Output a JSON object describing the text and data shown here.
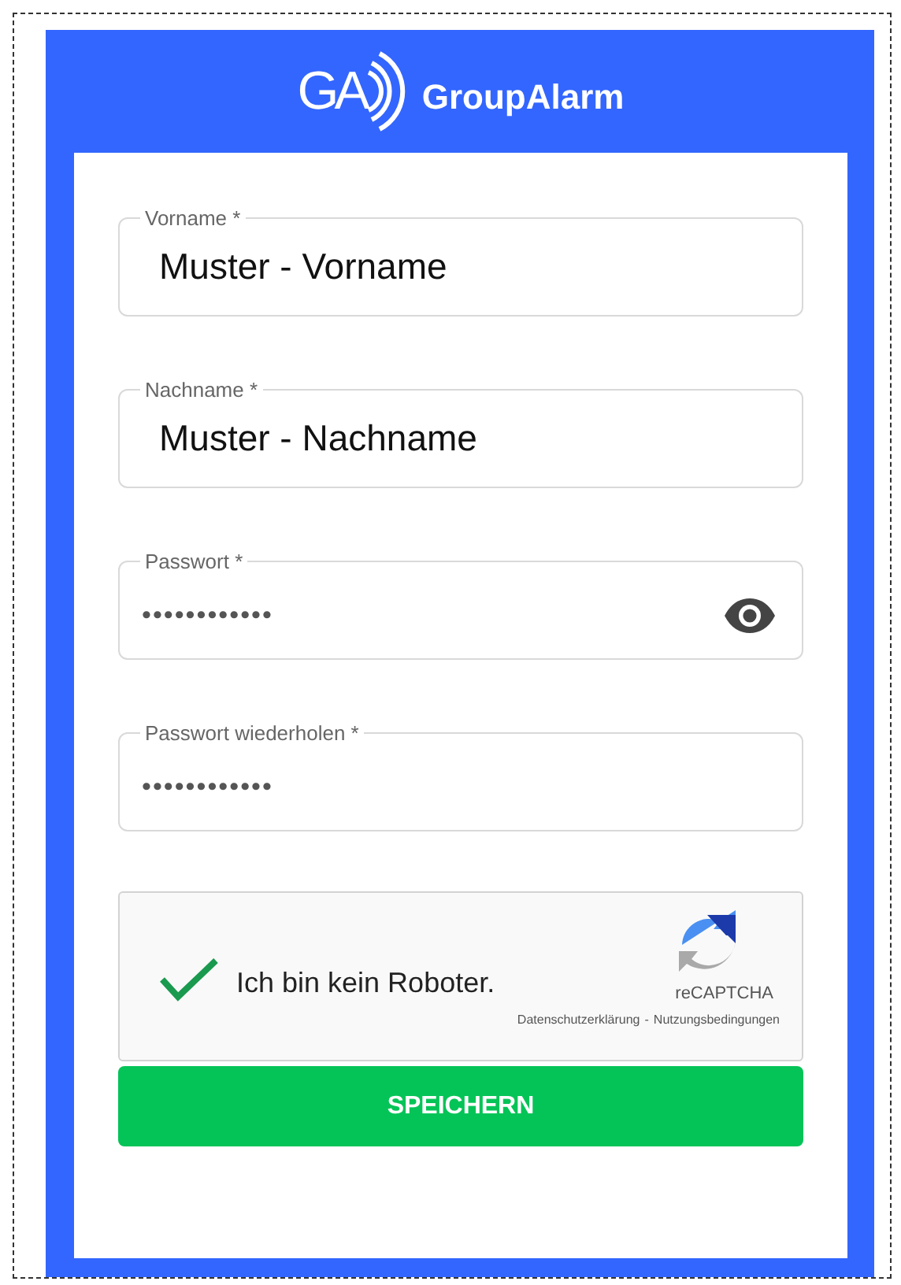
{
  "logo": {
    "mark": "GA",
    "name": "GroupAlarm"
  },
  "fields": [
    {
      "label": "Vorname *",
      "value": "Muster - Vorname",
      "kind": "text"
    },
    {
      "label": "Nachname *",
      "value": "Muster - Nachname",
      "kind": "text"
    },
    {
      "label": "Passwort *",
      "value": "••••••••••••",
      "kind": "password-toggle"
    },
    {
      "label": "Passwort wiederholen *",
      "value": "••••••••••••",
      "kind": "password"
    }
  ],
  "captcha": {
    "checked": true,
    "label": "Ich bin kein Roboter.",
    "brand": "reCAPTCHA",
    "privacy": "Datenschutzerklärung",
    "separator": "-",
    "terms": "Nutzungsbedingungen"
  },
  "submit": "SPEICHERN"
}
